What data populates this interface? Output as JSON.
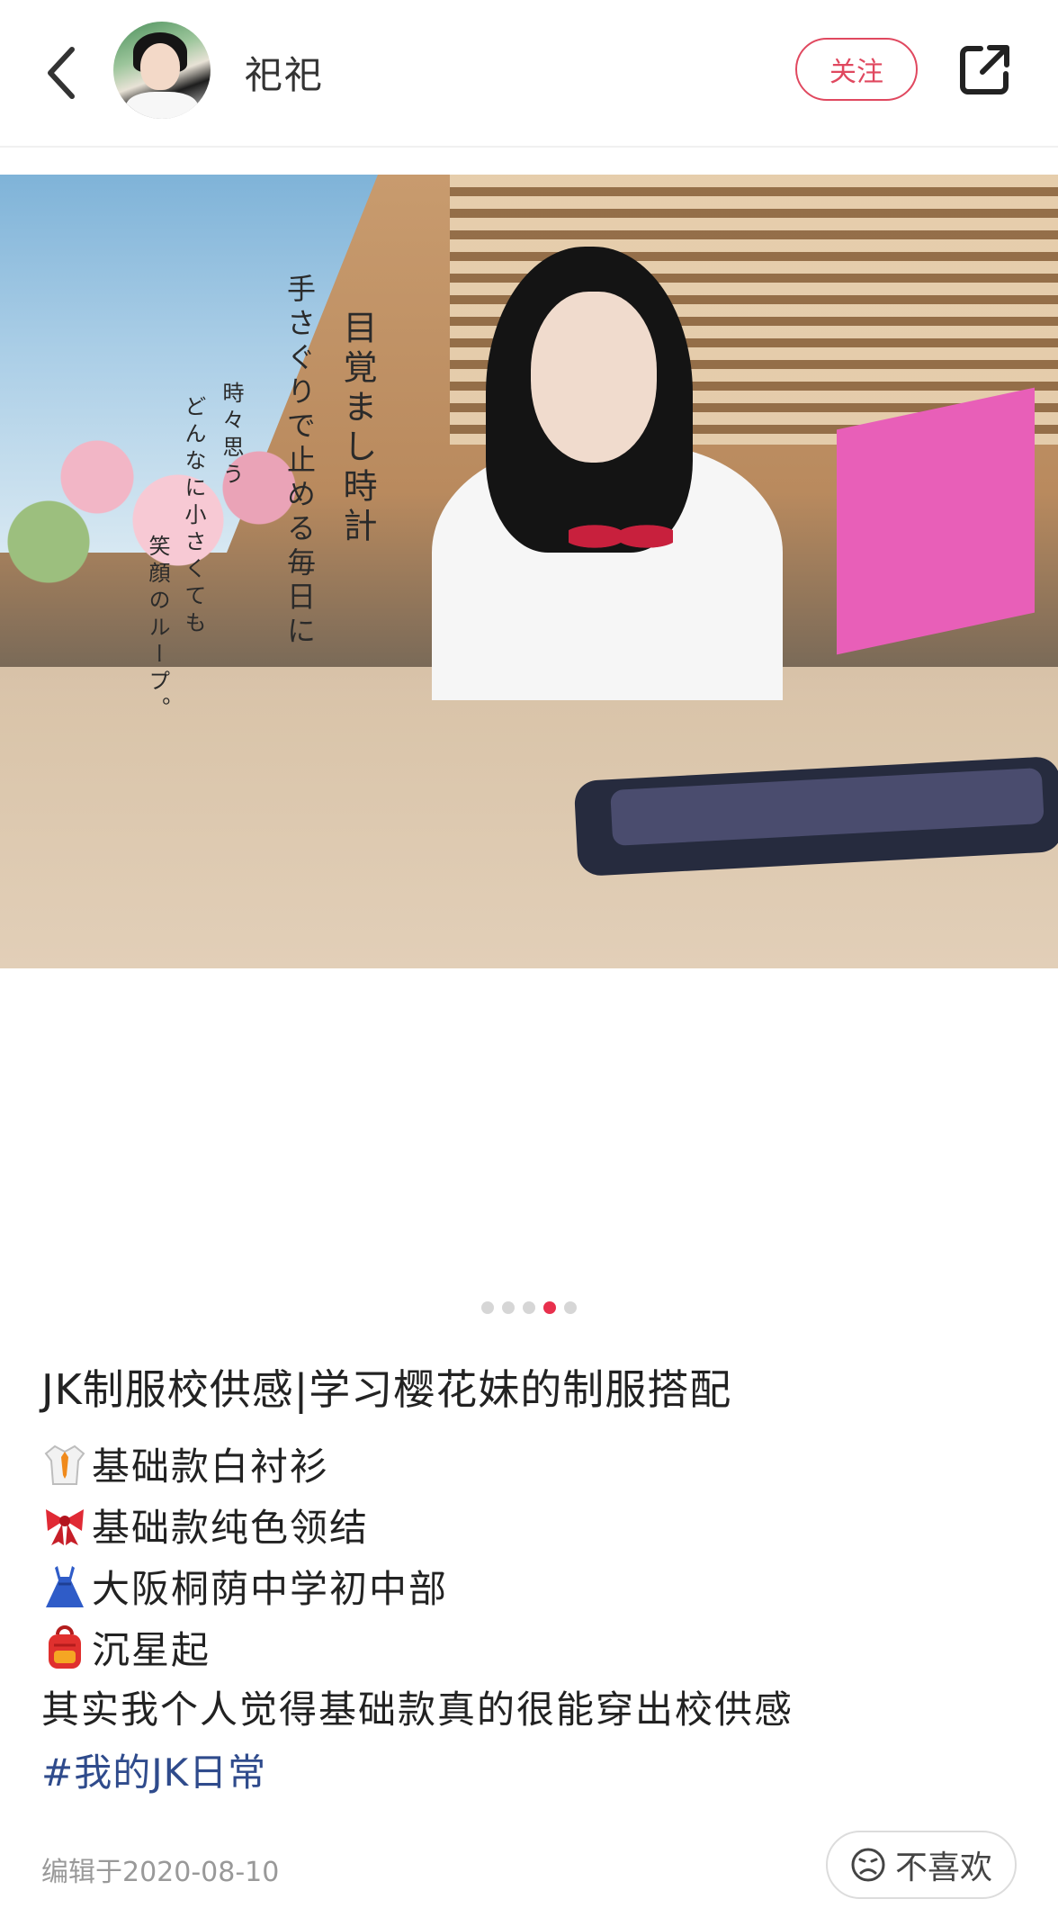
{
  "header": {
    "username": "祀祀",
    "follow_label": "关注"
  },
  "photo": {
    "overlay_lines": [
      "目覚まし時計",
      "手さぐりで止める毎日に",
      "時々思う",
      "どんなに小さくても",
      "笑顔のループ。"
    ],
    "current_index": 4,
    "total": 5
  },
  "post": {
    "title": "JK制服校供感|学习樱花妹的制服搭配",
    "lines": [
      {
        "icon": "shirt-tie-icon",
        "text": "基础款白衬衫"
      },
      {
        "icon": "ribbon-icon",
        "text": "基础款纯色领结"
      },
      {
        "icon": "dress-icon",
        "text": "大阪桐荫中学初中部"
      },
      {
        "icon": "backpack-icon",
        "text": "沉星起"
      }
    ],
    "note": "其实我个人觉得基础款真的很能穿出校供感",
    "hashtag": "#我的JK日常",
    "edited": "编辑于2020-08-10"
  },
  "footer": {
    "dislike_label": "不喜欢"
  },
  "colors": {
    "accent": "#e0485f",
    "dot_active": "#e8304d",
    "hashtag": "#2f4b8c"
  }
}
